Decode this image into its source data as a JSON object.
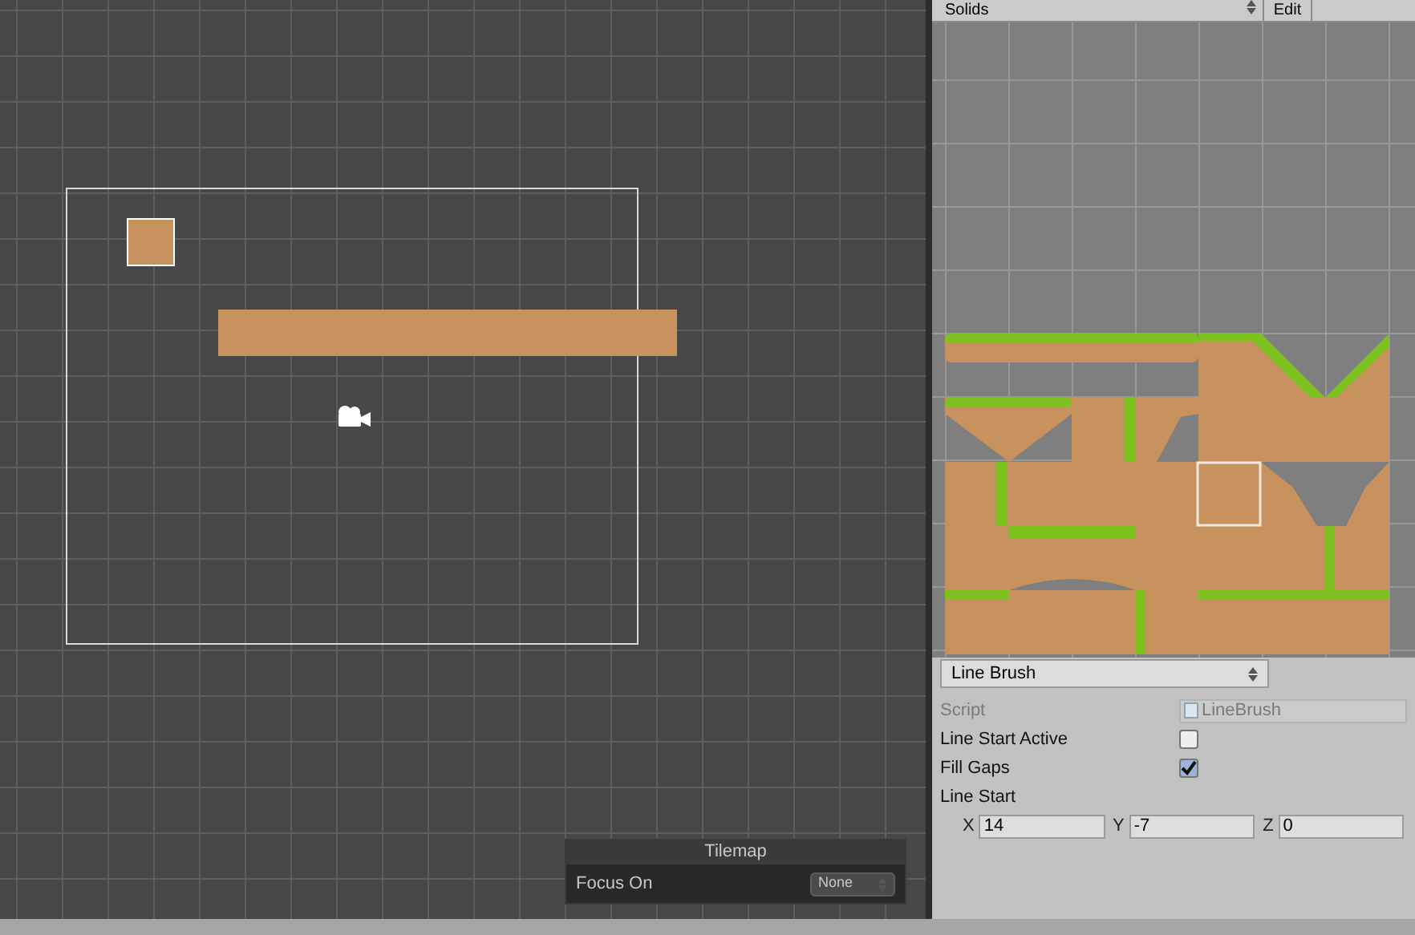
{
  "palette_toolbar": {
    "palette_dropdown": "Solids",
    "edit_button": "Edit"
  },
  "brush_dropdown": "Line Brush",
  "inspector": {
    "fields": [
      {
        "kind": "object",
        "label": "Script",
        "value": "LineBrush",
        "disabled": true
      },
      {
        "kind": "checkbox",
        "label": "Line Start Active",
        "checked": false
      },
      {
        "kind": "checkbox",
        "label": "Fill Gaps",
        "checked": true
      },
      {
        "kind": "vector",
        "label": "Line Start",
        "components": [
          {
            "axis": "X",
            "value": "14"
          },
          {
            "axis": "Y",
            "value": "-7"
          },
          {
            "axis": "Z",
            "value": "0"
          }
        ]
      }
    ]
  },
  "tilemap_overlay": {
    "title": "Tilemap",
    "focus_label": "Focus On",
    "focus_value": "None"
  }
}
